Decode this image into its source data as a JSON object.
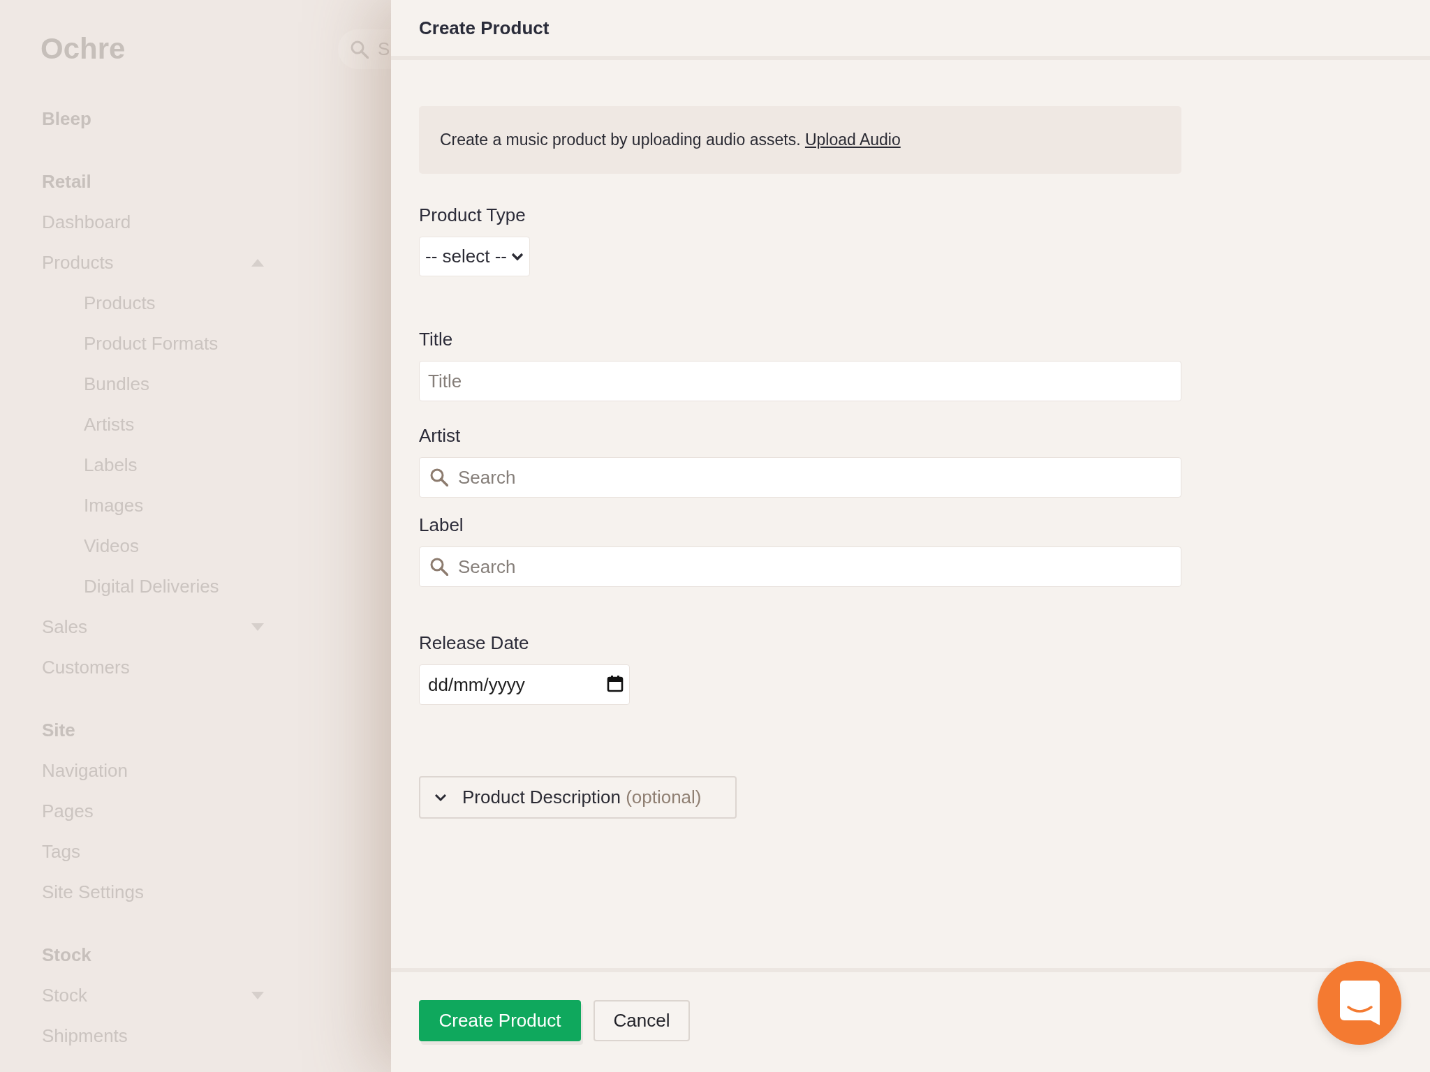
{
  "sidebar": {
    "logo": "Ochre",
    "sections": [
      {
        "heading": "Bleep"
      },
      {
        "heading": "Retail",
        "items": [
          {
            "kind": "link",
            "label": "Dashboard"
          },
          {
            "kind": "group",
            "label": "Products",
            "expanded": true,
            "children": [
              {
                "label": "Products"
              },
              {
                "label": "Product Formats"
              },
              {
                "label": "Bundles"
              },
              {
                "label": "Artists"
              },
              {
                "label": "Labels"
              },
              {
                "label": "Images"
              },
              {
                "label": "Videos"
              },
              {
                "label": "Digital Deliveries"
              }
            ]
          },
          {
            "kind": "group",
            "label": "Sales",
            "expanded": false
          },
          {
            "kind": "link",
            "label": "Customers"
          }
        ]
      },
      {
        "heading": "Site",
        "items": [
          {
            "kind": "link",
            "label": "Navigation"
          },
          {
            "kind": "link",
            "label": "Pages"
          },
          {
            "kind": "link",
            "label": "Tags"
          },
          {
            "kind": "link",
            "label": "Site Settings"
          }
        ]
      },
      {
        "heading": "Stock",
        "items": [
          {
            "kind": "group",
            "label": "Stock",
            "expanded": false
          },
          {
            "kind": "link",
            "label": "Shipments"
          }
        ]
      }
    ]
  },
  "top_search": {
    "placeholder": "S"
  },
  "panel": {
    "title": "Create Product",
    "notice": {
      "text": "Create a music product by uploading audio assets.",
      "link": "Upload Audio"
    },
    "fields": [
      {
        "kind": "select",
        "label": "Product Type",
        "value": "-- select --"
      },
      {
        "kind": "text",
        "label": "Title",
        "placeholder": "Title"
      },
      {
        "kind": "search",
        "label": "Artist",
        "placeholder": "Search"
      },
      {
        "kind": "search",
        "label": "Label",
        "placeholder": "Search"
      },
      {
        "kind": "date",
        "label": "Release Date",
        "placeholder": "dd/mm/yyyy"
      }
    ],
    "accordion": {
      "label": "Product Description",
      "hint": "(optional)",
      "expanded": false
    },
    "buttons": [
      {
        "kind": "primary",
        "label": "Create Product"
      },
      {
        "kind": "secondary",
        "label": "Cancel"
      }
    ]
  }
}
